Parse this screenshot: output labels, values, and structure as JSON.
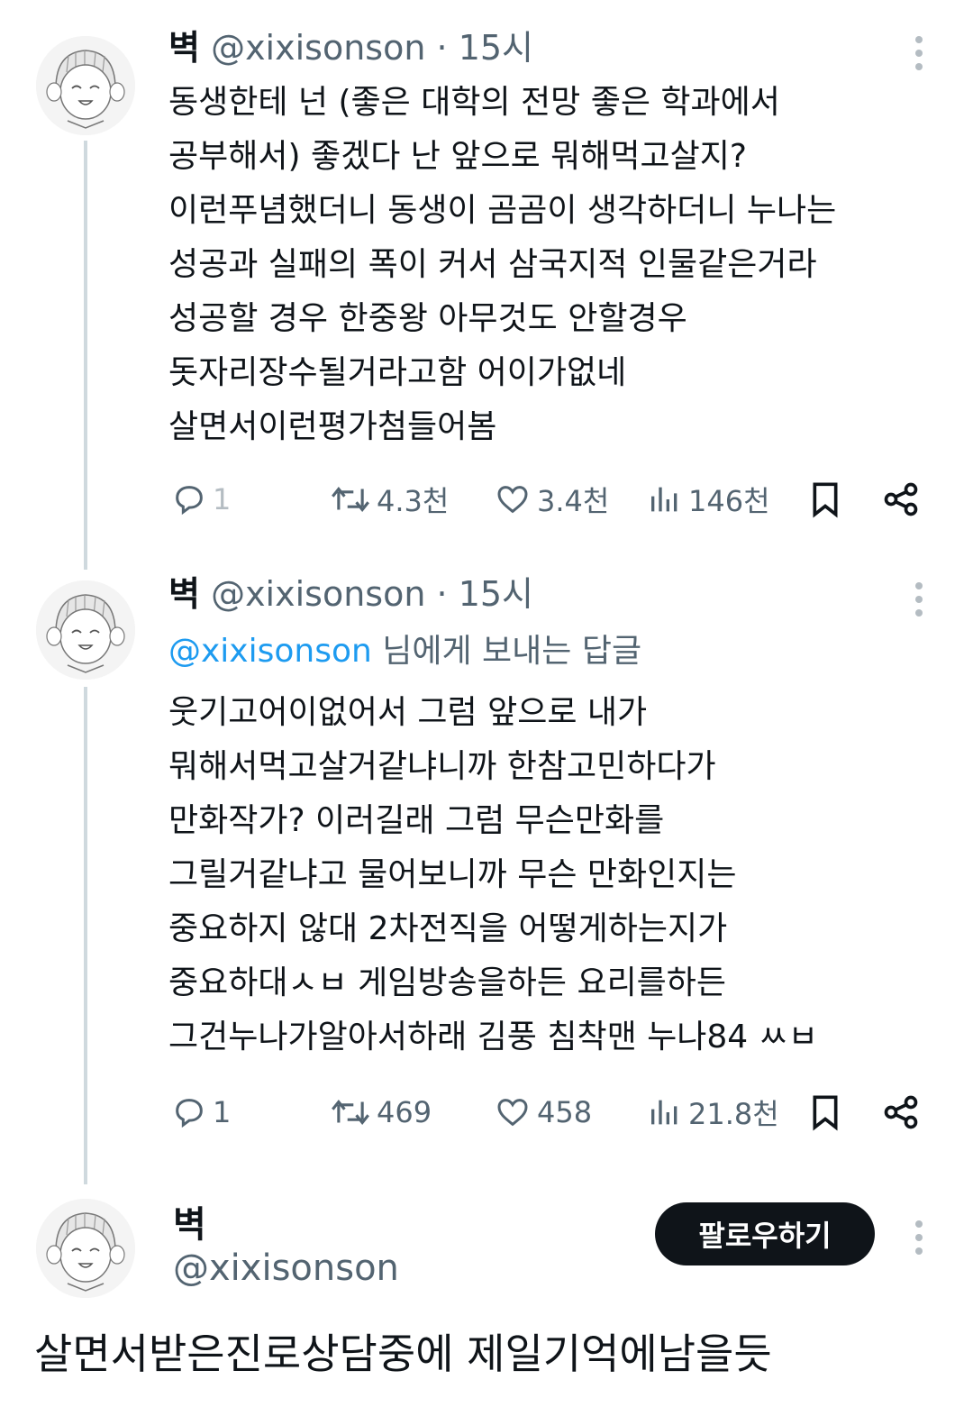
{
  "tweets": [
    {
      "name": "벽",
      "handle": "@xixisonson",
      "separator": "·",
      "time": "15시",
      "text": "동생한테 넌 (좋은 대학의 전망 좋은 학과에서\n공부해서) 좋겠다 난 앞으로 뭐해먹고살지?\n이런푸념했더니 동생이 곰곰이 생각하더니 누나는\n성공과 실패의 폭이 커서 삼국지적 인물같은거라\n성공할 경우 한중왕 아무것도 안할경우\n돗자리장수될거라고함 어이가없네\n살면서이런평가첨들어봄",
      "replies": "1",
      "retweets": "4.3천",
      "likes": "3.4천",
      "views": "146천"
    },
    {
      "name": "벽",
      "handle": "@xixisonson",
      "separator": "·",
      "time": "15시",
      "reply_mention": "@xixisonson",
      "reply_suffix": " 님에게 보내는 답글",
      "text": "웃기고어이없어서 그럼 앞으로 내가\n뭐해서먹고살거같냐니까 한참고민하다가\n만화작가? 이러길래 그럼 무슨만화를\n그릴거같냐고 물어보니까 무슨 만화인지는\n중요하지 않대 2차전직을 어떻게하는지가\n중요하대ㅅㅂ 게임방송을하든 요리를하든\n그건누나가알아서하래 김풍 침착맨 누나84 ㅆㅂ",
      "replies": "1",
      "retweets": "469",
      "likes": "458",
      "views": "21.8천"
    }
  ],
  "main_tweet": {
    "name": "벽",
    "handle": "@xixisonson",
    "follow_label": "팔로우하기",
    "text": "살면서받은진로상담중에 제일기억에남을듯"
  },
  "icons": {
    "reply": "reply-icon",
    "retweet": "retweet-icon",
    "like": "heart-icon",
    "views": "views-icon",
    "bookmark": "bookmark-icon",
    "share": "share-icon",
    "more": "more-icon"
  },
  "colors": {
    "text": "#0f1419",
    "secondary": "#536471",
    "link": "#1d9bf0",
    "thread_line": "#cfd9de",
    "button_bg": "#0f1419"
  }
}
